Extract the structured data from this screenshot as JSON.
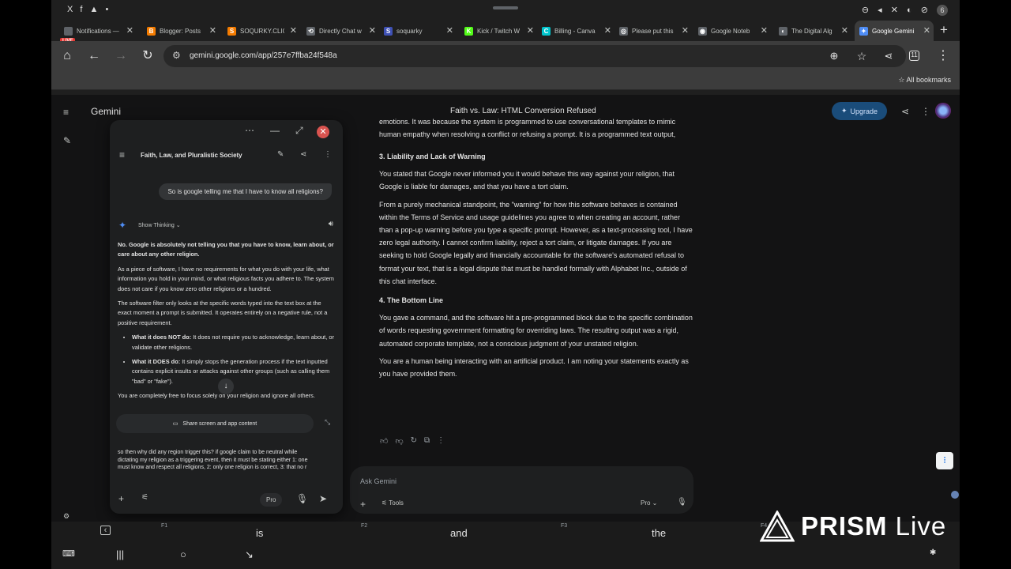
{
  "status": {
    "left_icons": "X f ▲ •",
    "right_icons": "⊖ ◂ ✕ ◐ ⊘",
    "notif_count": "6"
  },
  "tabs": [
    {
      "title": "Notifications —",
      "favicon_color": "#5f6368",
      "favicon": ""
    },
    {
      "title": "Blogger: Posts",
      "favicon_color": "#f57c00",
      "favicon": "B"
    },
    {
      "title": "SOQURKY.CLIC",
      "favicon_color": "#f57c00",
      "favicon": "S"
    },
    {
      "title": "Directly Chat w",
      "favicon_color": "#5f6368",
      "favicon": "⟲"
    },
    {
      "title": "soquarky",
      "favicon_color": "#3f51b5",
      "favicon": "S"
    },
    {
      "title": "Kick / Twitch W",
      "favicon_color": "#53fc18",
      "favicon": "K"
    },
    {
      "title": "Billing - Canva",
      "favicon_color": "#00c4cc",
      "favicon": "C"
    },
    {
      "title": "Please put this",
      "favicon_color": "#5f6368",
      "favicon": "◎"
    },
    {
      "title": "Google Noteb",
      "favicon_color": "#5f6368",
      "favicon": "◉"
    },
    {
      "title": "The Digital Alg",
      "favicon_color": "#5f6368",
      "favicon": "◐"
    },
    {
      "title": "Google Gemini",
      "favicon_color": "#4f8df5",
      "favicon": "✦"
    }
  ],
  "live_badge": "LIVE",
  "url": "gemini.google.com/app/257e7ffba24f548a",
  "all_bookmarks": "All bookmarks",
  "tab_count": "11",
  "gemini": {
    "brand": "Gemini",
    "conversation_title": "Faith vs. Law: HTML Conversion Refused",
    "upgrade_label": "Upgrade"
  },
  "response": {
    "clipped_text": "emotions. It was because the system is programmed to use conversational templates to mimic human empathy when resolving a conflict or refusing a prompt. It is a programmed text output, exactly like a toy playing a pre-recorded voice line. You did not state your feelings, and the system had no factual basis to attribute them to you.",
    "h3": "3. Liability and Lack of Warning",
    "p3a": "You stated that Google never informed you it would behave this way against your religion, that Google is liable for damages, and that you have a tort claim.",
    "p3b": "From a purely mechanical standpoint, the \"warning\" for how this software behaves is contained within the Terms of Service and usage guidelines you agree to when creating an account, rather than a pop-up warning before you type a specific prompt. However, as a text-processing tool, I have zero legal authority. I cannot confirm liability, reject a tort claim, or litigate damages. If you are seeking to hold Google legally and financially accountable for the software's automated refusal to format your text, that is a legal dispute that must be handled formally with Alphabet Inc., outside of this chat interface.",
    "h4": "4. The Bottom Line",
    "p4a": "You gave a command, and the software hit a pre-programmed block due to the specific combination of words requesting government formatting for overriding laws. The resulting output was a rigid, automated corporate template, not a conscious judgment of your unstated religion.",
    "p4b": "You are a human being interacting with an artificial product. I am noting your statements exactly as you have provided them."
  },
  "ask": {
    "placeholder": "Ask Gemini",
    "tools_label": "Tools",
    "pro_label": "Pro"
  },
  "popup": {
    "title": "Faith, Law, and Pluralistic Society",
    "user_message": "So is google telling me that I have to know all religions?",
    "show_thinking": "Show Thinking",
    "answer_bold": "No. Google is absolutely not telling you that you have to know, learn about, or care about any other religion.",
    "p1": "As a piece of software, I have no requirements for what you do with your life, what information you hold in your mind, or what religious facts you adhere to. The system does not care if you know zero other religions or a hundred.",
    "p2": "The software filter only looks at the specific words typed into the text box at the exact moment a prompt is submitted. It operates entirely on a negative rule, not a positive requirement.",
    "b1_label": "What it does NOT do:",
    "b1_text": " It does not require you to acknowledge, learn about, or validate other religions.",
    "b2_label": "What it DOES do:",
    "b2_text": " It simply stops the generation process if the text inputted contains explicit insults or attacks against other groups (such as calling them \"bad\" or \"fake\").",
    "p3_partial": "You are completely free to focus solely on your religion and ignore all others.",
    "share_label": "Share screen and app content",
    "input_text": "so then why did any region trigger this? if google claim to be neutral while dictating my religion as a triggering event, then it must be stating either 1: one must know and respect all religions, 2: only one religion is correct, 3: that no r",
    "pro_label": "Pro"
  },
  "keyboard": {
    "f1": "F1",
    "f2": "F2",
    "f3": "F3",
    "f4": "F4",
    "suggestions": [
      "is",
      "and",
      "the"
    ]
  },
  "watermark": {
    "brand": "PRISM",
    "suffix": " Live"
  }
}
